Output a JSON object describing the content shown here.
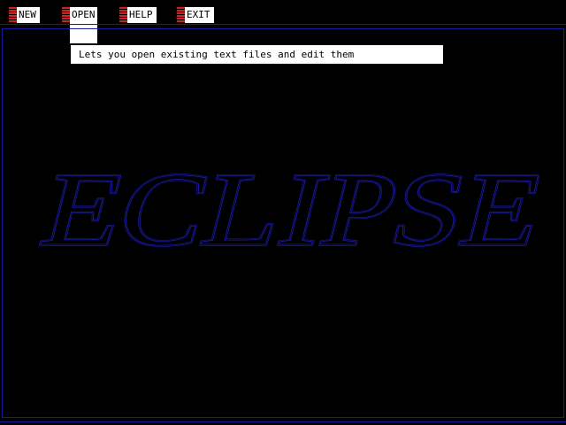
{
  "menu": {
    "items": [
      {
        "label": "NEW"
      },
      {
        "label": "OPEN"
      },
      {
        "label": "HELP"
      },
      {
        "label": "EXIT"
      }
    ]
  },
  "hint": {
    "text": "Lets you open existing text files and edit them"
  },
  "logo": {
    "text": "ECLIPSE"
  },
  "colors": {
    "background": "#000000",
    "frame_line": "#1a1aa0",
    "menu_stripe": "#cc2222",
    "menu_label_bg": "#ffffff",
    "logo_outline": "#1a1ab0"
  }
}
